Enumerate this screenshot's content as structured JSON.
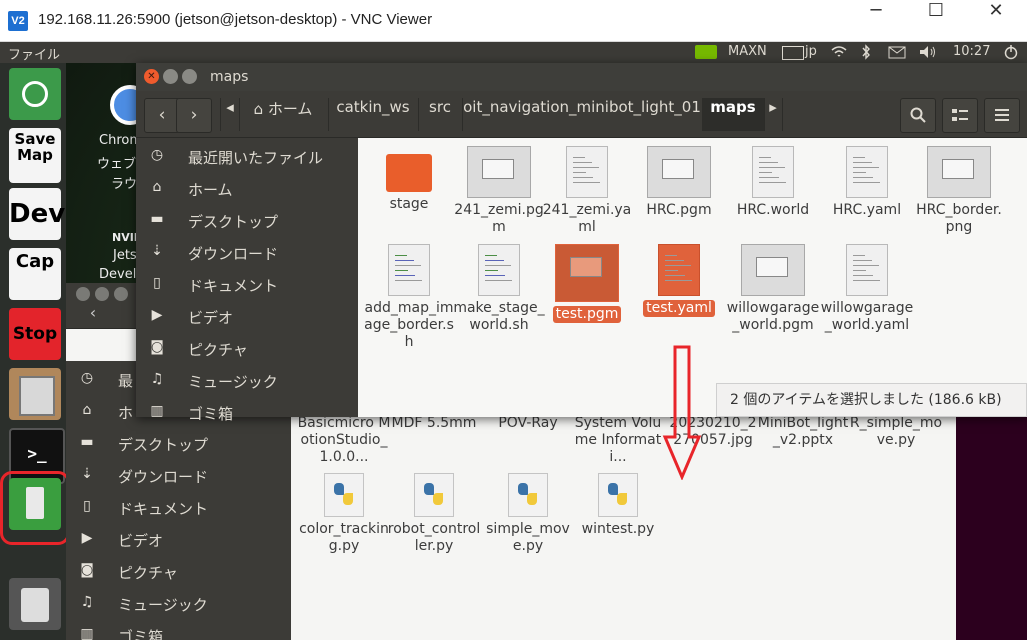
{
  "vnc": {
    "title": "192.168.11.26:5900 (jetson@jetson-desktop) - VNC Viewer",
    "logo": "V2",
    "minimize": "─",
    "maximize": "☐",
    "close": "✕"
  },
  "panel": {
    "menu": "ファイル",
    "nvidia": "MAXN",
    "keyboard": "jp",
    "time": "10:27"
  },
  "launcher": {
    "items": [
      {
        "name": "ubuntu",
        "label": ""
      },
      {
        "name": "save-map",
        "label": "Save Map"
      },
      {
        "name": "dev",
        "label": "Dev"
      },
      {
        "name": "cap",
        "label": "Cap"
      },
      {
        "name": "stop",
        "label": "Stop"
      },
      {
        "name": "files",
        "label": ""
      },
      {
        "name": "terminal",
        "label": ">_"
      },
      {
        "name": "usb",
        "label": ""
      },
      {
        "name": "trash",
        "label": ""
      }
    ]
  },
  "desktop_icons": {
    "chrome_label1": "Chrom",
    "chrome_label2": "ウェブ",
    "chrome_label3": "ラウ",
    "nvidia_label1": "NVIDI",
    "nvidia_label2": "Jets",
    "nvidia_label3": "Devel"
  },
  "window": {
    "title": "maps",
    "breadcrumbs": [
      "ホーム",
      "catkin_ws",
      "src",
      "oit_navigation_minibot_light_01",
      "maps"
    ],
    "sidebar": [
      {
        "icon": "clock-icon",
        "label": "最近開いたファイル"
      },
      {
        "icon": "home-icon",
        "label": "ホーム"
      },
      {
        "icon": "folder-icon",
        "label": "デスクトップ"
      },
      {
        "icon": "download-icon",
        "label": "ダウンロード"
      },
      {
        "icon": "document-icon",
        "label": "ドキュメント"
      },
      {
        "icon": "video-icon",
        "label": "ビデオ"
      },
      {
        "icon": "camera-icon",
        "label": "ピクチャ"
      },
      {
        "icon": "music-icon",
        "label": "ミュージック"
      },
      {
        "icon": "trash-icon",
        "label": "ゴミ箱"
      }
    ],
    "files": [
      {
        "name": "stage",
        "type": "folder",
        "selected": false
      },
      {
        "name": "241_zemi.pgm",
        "type": "image",
        "selected": false
      },
      {
        "name": "241_zemi.yaml",
        "type": "text",
        "selected": false
      },
      {
        "name": "HRC.pgm",
        "type": "image",
        "selected": false
      },
      {
        "name": "HRC.world",
        "type": "text",
        "selected": false
      },
      {
        "name": "HRC.yaml",
        "type": "text",
        "selected": false
      },
      {
        "name": "HRC_border.png",
        "type": "image",
        "selected": false
      },
      {
        "name": "add_map_image_border.sh",
        "type": "script",
        "selected": false
      },
      {
        "name": "make_stage_world.sh",
        "type": "script",
        "selected": false
      },
      {
        "name": "test.pgm",
        "type": "image",
        "selected": true
      },
      {
        "name": "test.yaml",
        "type": "text",
        "selected": true
      },
      {
        "name": "willowgarage_world.pgm",
        "type": "image",
        "selected": false
      },
      {
        "name": "willowgarage_world.yaml",
        "type": "text",
        "selected": false
      }
    ],
    "status": "2 個のアイテムを選択しました (186.6 kB)"
  },
  "bg_window": {
    "sidebar": [
      {
        "icon": "clock-icon",
        "label": "最"
      },
      {
        "icon": "home-icon",
        "label": "ホ"
      },
      {
        "icon": "folder-icon",
        "label": "デスクトップ"
      },
      {
        "icon": "download-icon",
        "label": "ダウンロード"
      },
      {
        "icon": "document-icon",
        "label": "ドキュメント"
      },
      {
        "icon": "video-icon",
        "label": "ビデオ"
      },
      {
        "icon": "camera-icon",
        "label": "ピクチャ"
      },
      {
        "icon": "music-icon",
        "label": "ミュージック"
      },
      {
        "icon": "trash-icon",
        "label": "ゴミ箱"
      }
    ],
    "row1": [
      "Basicmicro MotionStudio_1.0.0...",
      "MDF 5.5mm",
      "POV-Ray",
      "System Volume Informati...",
      "20230210_2270057.jpg",
      "MiniBot_light_v2.pptx",
      "R_simple_move.py"
    ],
    "row2": [
      "color_tracking.py",
      "robot_controller.py",
      "simple_move.py",
      "wintest.py"
    ]
  },
  "annotation": {
    "color": "#e8252a"
  }
}
